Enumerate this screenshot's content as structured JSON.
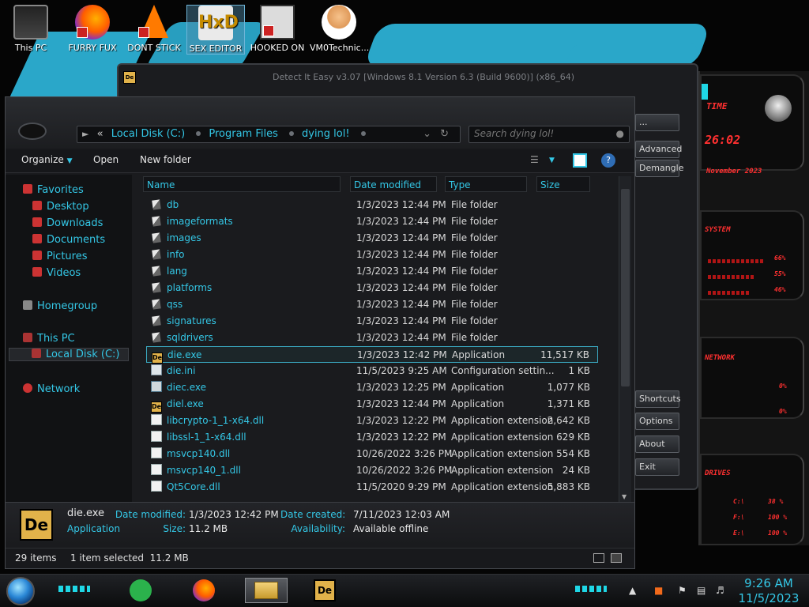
{
  "desktop": {
    "icons": [
      {
        "label": "This PC"
      },
      {
        "label": "FURRY FUX"
      },
      {
        "label": "DONT STICK THIS IN YO"
      },
      {
        "label": "SEX EDITOR"
      },
      {
        "label": "HOOKED ON XONIX"
      },
      {
        "label": "VM0Technic..."
      }
    ]
  },
  "back_window": {
    "title": "Detect It Easy v3.07 [Windows 8.1 Version 6.3 (Build 9600)] (x86_64)",
    "buttons": [
      "...",
      "Advanced",
      "Demangle",
      "Shortcuts",
      "Options",
      "About",
      "Exit"
    ]
  },
  "gadget": {
    "time": "26:02",
    "time_label": "TIME",
    "date": "November 2023",
    "system_label": "SYSTEM",
    "system_values": [
      "66%",
      "55%",
      "46%"
    ],
    "network_label": "NETWORK",
    "network_values": [
      "0%",
      "0%"
    ],
    "drives_label": "DRIVES",
    "drives": [
      {
        "letter": "C:\\",
        "value": "38 %"
      },
      {
        "letter": "F:\\",
        "value": "100 %"
      },
      {
        "letter": "E:\\",
        "value": "100 %"
      }
    ]
  },
  "explorer": {
    "address": {
      "root": "«",
      "parts": [
        "Local Disk (C:)",
        "Program Files",
        "dying lol!"
      ]
    },
    "search_placeholder": "Search dying lol!",
    "toolbar": {
      "organize": "Organize",
      "open": "Open",
      "new_folder": "New folder"
    },
    "nav": {
      "favorites": "Favorites",
      "desktop": "Desktop",
      "downloads": "Downloads",
      "documents": "Documents",
      "pictures": "Pictures",
      "videos": "Videos",
      "homegroup": "Homegroup",
      "this_pc": "This PC",
      "local_disk": "Local Disk (C:)",
      "network": "Network"
    },
    "columns": {
      "name": "Name",
      "date": "Date modified",
      "type": "Type",
      "size": "Size"
    },
    "files": [
      {
        "name": "db",
        "date": "1/3/2023 12:44 PM",
        "type": "File folder",
        "size": "",
        "kind": "folder"
      },
      {
        "name": "imageformats",
        "date": "1/3/2023 12:44 PM",
        "type": "File folder",
        "size": "",
        "kind": "folder"
      },
      {
        "name": "images",
        "date": "1/3/2023 12:44 PM",
        "type": "File folder",
        "size": "",
        "kind": "folder"
      },
      {
        "name": "info",
        "date": "1/3/2023 12:44 PM",
        "type": "File folder",
        "size": "",
        "kind": "folder"
      },
      {
        "name": "lang",
        "date": "1/3/2023 12:44 PM",
        "type": "File folder",
        "size": "",
        "kind": "folder"
      },
      {
        "name": "platforms",
        "date": "1/3/2023 12:44 PM",
        "type": "File folder",
        "size": "",
        "kind": "folder"
      },
      {
        "name": "qss",
        "date": "1/3/2023 12:44 PM",
        "type": "File folder",
        "size": "",
        "kind": "folder"
      },
      {
        "name": "signatures",
        "date": "1/3/2023 12:44 PM",
        "type": "File folder",
        "size": "",
        "kind": "folder"
      },
      {
        "name": "sqldrivers",
        "date": "1/3/2023 12:44 PM",
        "type": "File folder",
        "size": "",
        "kind": "folder"
      },
      {
        "name": "die.exe",
        "date": "1/3/2023 12:42 PM",
        "type": "Application",
        "size": "11,517 KB",
        "kind": "die",
        "selected": true
      },
      {
        "name": "die.ini",
        "date": "11/5/2023 9:25 AM",
        "type": "Configuration settin...",
        "size": "1 KB",
        "kind": "ini"
      },
      {
        "name": "diec.exe",
        "date": "1/3/2023 12:25 PM",
        "type": "Application",
        "size": "1,077 KB",
        "kind": "app"
      },
      {
        "name": "diel.exe",
        "date": "1/3/2023 12:44 PM",
        "type": "Application",
        "size": "1,371 KB",
        "kind": "die"
      },
      {
        "name": "libcrypto-1_1-x64.dll",
        "date": "1/3/2023 12:22 PM",
        "type": "Application extension",
        "size": "2,642 KB",
        "kind": "dll"
      },
      {
        "name": "libssl-1_1-x64.dll",
        "date": "1/3/2023 12:22 PM",
        "type": "Application extension",
        "size": "629 KB",
        "kind": "dll"
      },
      {
        "name": "msvcp140.dll",
        "date": "10/26/2022 3:26 PM",
        "type": "Application extension",
        "size": "554 KB",
        "kind": "dll"
      },
      {
        "name": "msvcp140_1.dll",
        "date": "10/26/2022 3:26 PM",
        "type": "Application extension",
        "size": "24 KB",
        "kind": "dll"
      },
      {
        "name": "Qt5Core.dll",
        "date": "11/5/2020 9:29 PM",
        "type": "Application extension",
        "size": "5,883 KB",
        "kind": "dll"
      }
    ],
    "details": {
      "name": "die.exe",
      "kind": "Application",
      "date_modified_label": "Date modified:",
      "date_modified": "1/3/2023 12:42 PM",
      "date_created_label": "Date created:",
      "date_created": "7/11/2023 12:03 AM",
      "size_label": "Size:",
      "size": "11.2 MB",
      "availability_label": "Availability:",
      "availability": "Available offline"
    },
    "status": {
      "items": "29 items",
      "selected": "1 item selected  11.2 MB"
    }
  },
  "taskbar": {
    "time": "9:26 AM",
    "date": "11/5/2023"
  },
  "colors": {
    "accent": "#34c7e6",
    "gadget_red": "#ff3030",
    "bg": "#1a1b1e"
  }
}
